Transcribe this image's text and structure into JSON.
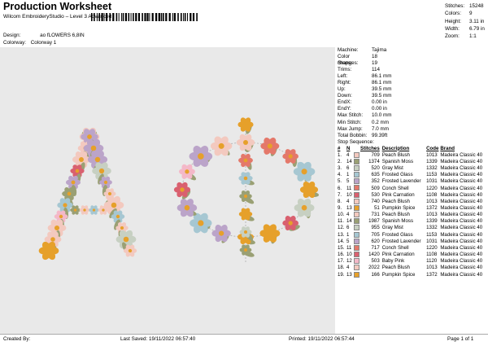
{
  "header": {
    "title": "Production Worksheet",
    "subtitle": "Wilcom EmbroideryStudio – Level 3 Advanced",
    "design_label": "Design:",
    "design_value": "ao fLOWERS 6,8IN",
    "colorway_label": "Colorway:",
    "colorway_value": "Colorway 1"
  },
  "stats": [
    {
      "k": "Stitches:",
      "v": "15248"
    },
    {
      "k": "Colors:",
      "v": "9"
    },
    {
      "k": "Height:",
      "v": "3.11 in"
    },
    {
      "k": "Width:",
      "v": "6.79 in"
    },
    {
      "k": "Zoom:",
      "v": "1:1"
    }
  ],
  "details": [
    {
      "k": "Machine:",
      "v": "Tajima"
    },
    {
      "k": "Color changes:",
      "v": "18"
    },
    {
      "k": "Stops:",
      "v": "19"
    },
    {
      "k": "Trims:",
      "v": "114"
    },
    {
      "k": "Left:",
      "v": "86.1 mm"
    },
    {
      "k": "Right:",
      "v": "86.1 mm"
    },
    {
      "k": "Up:",
      "v": "39.5 mm"
    },
    {
      "k": "Down:",
      "v": "39.5 mm"
    },
    {
      "k": "EndX:",
      "v": "0.00 in"
    },
    {
      "k": "EndY:",
      "v": "0.00 in"
    },
    {
      "k": "Max Stitch:",
      "v": "10.0 mm"
    },
    {
      "k": "Min Stitch:",
      "v": "0.2 mm"
    },
    {
      "k": "Max Jump:",
      "v": "7.0 mm"
    },
    {
      "k": "Total Bobbin:",
      "v": "99.39ft"
    }
  ],
  "stop_sequence": {
    "title": "Stop Sequence:",
    "headers": [
      "#",
      "N",
      "",
      "Stitches",
      "Description",
      "Code",
      "Brand"
    ],
    "rows": [
      {
        "n": "1.",
        "needle": "4",
        "color": "#f3c9bf",
        "stitches": "709",
        "desc": "Peach Blush",
        "code": "1013",
        "brand": "Madeira Classic 40"
      },
      {
        "n": "2.",
        "needle": "14",
        "color": "#9aa074",
        "stitches": "1374",
        "desc": "Spanish Moss",
        "code": "1339",
        "brand": "Madeira Classic 40"
      },
      {
        "n": "3.",
        "needle": "6",
        "color": "#c7d0c2",
        "stitches": "520",
        "desc": "Gray Mist",
        "code": "1332",
        "brand": "Madeira Classic 40"
      },
      {
        "n": "4.",
        "needle": "1",
        "color": "#a6c7d2",
        "stitches": "635",
        "desc": "Frosted Glass",
        "code": "1153",
        "brand": "Madeira Classic 40"
      },
      {
        "n": "5.",
        "needle": "5",
        "color": "#bba4c9",
        "stitches": "352",
        "desc": "Frosted Lavender",
        "code": "1031",
        "brand": "Madeira Classic 40"
      },
      {
        "n": "6.",
        "needle": "11",
        "color": "#e4786a",
        "stitches": "509",
        "desc": "Conch Shell",
        "code": "1220",
        "brand": "Madeira Classic 40"
      },
      {
        "n": "7.",
        "needle": "10",
        "color": "#d9606f",
        "stitches": "530",
        "desc": "Pink Carnation",
        "code": "1108",
        "brand": "Madeira Classic 40"
      },
      {
        "n": "8.",
        "needle": "4",
        "color": "#f3c9bf",
        "stitches": "740",
        "desc": "Peach Blush",
        "code": "1013",
        "brand": "Madeira Classic 40"
      },
      {
        "n": "9.",
        "needle": "13",
        "color": "#e6a02a",
        "stitches": "51",
        "desc": "Pumpkin Spice",
        "code": "1372",
        "brand": "Madeira Classic 40"
      },
      {
        "n": "10.",
        "needle": "4",
        "color": "#f3c9bf",
        "stitches": "731",
        "desc": "Peach Blush",
        "code": "1013",
        "brand": "Madeira Classic 40"
      },
      {
        "n": "11.",
        "needle": "14",
        "color": "#9aa074",
        "stitches": "1987",
        "desc": "Spanish Moss",
        "code": "1339",
        "brand": "Madeira Classic 40"
      },
      {
        "n": "12.",
        "needle": "6",
        "color": "#c7d0c2",
        "stitches": "955",
        "desc": "Gray Mist",
        "code": "1332",
        "brand": "Madeira Classic 40"
      },
      {
        "n": "13.",
        "needle": "1",
        "color": "#a6c7d2",
        "stitches": "705",
        "desc": "Frosted Glass",
        "code": "1153",
        "brand": "Madeira Classic 40"
      },
      {
        "n": "14.",
        "needle": "5",
        "color": "#bba4c9",
        "stitches": "620",
        "desc": "Frosted Lavender",
        "code": "1031",
        "brand": "Madeira Classic 40"
      },
      {
        "n": "15.",
        "needle": "11",
        "color": "#e4786a",
        "stitches": "717",
        "desc": "Conch Shell",
        "code": "1220",
        "brand": "Madeira Classic 40"
      },
      {
        "n": "16.",
        "needle": "10",
        "color": "#d9606f",
        "stitches": "1420",
        "desc": "Pink Carnation",
        "code": "1108",
        "brand": "Madeira Classic 40"
      },
      {
        "n": "17.",
        "needle": "12",
        "color": "#f4b8c8",
        "stitches": "503",
        "desc": "Baby Pink",
        "code": "1120",
        "brand": "Madeira Classic 40"
      },
      {
        "n": "18.",
        "needle": "4",
        "color": "#f3c9bf",
        "stitches": "2022",
        "desc": "Peach Blush",
        "code": "1013",
        "brand": "Madeira Classic 40"
      },
      {
        "n": "19.",
        "needle": "13",
        "color": "#e6a02a",
        "stitches": "166",
        "desc": "Pumpkin Spice",
        "code": "1372",
        "brand": "Madeira Classic 40"
      }
    ]
  },
  "footer": {
    "created_by": "Created By:",
    "last_saved": "Last Saved: 19/11/2022 06:57:40",
    "printed": "Printed: 19/11/2022 06:57:44",
    "page": "Page 1 of 1"
  }
}
